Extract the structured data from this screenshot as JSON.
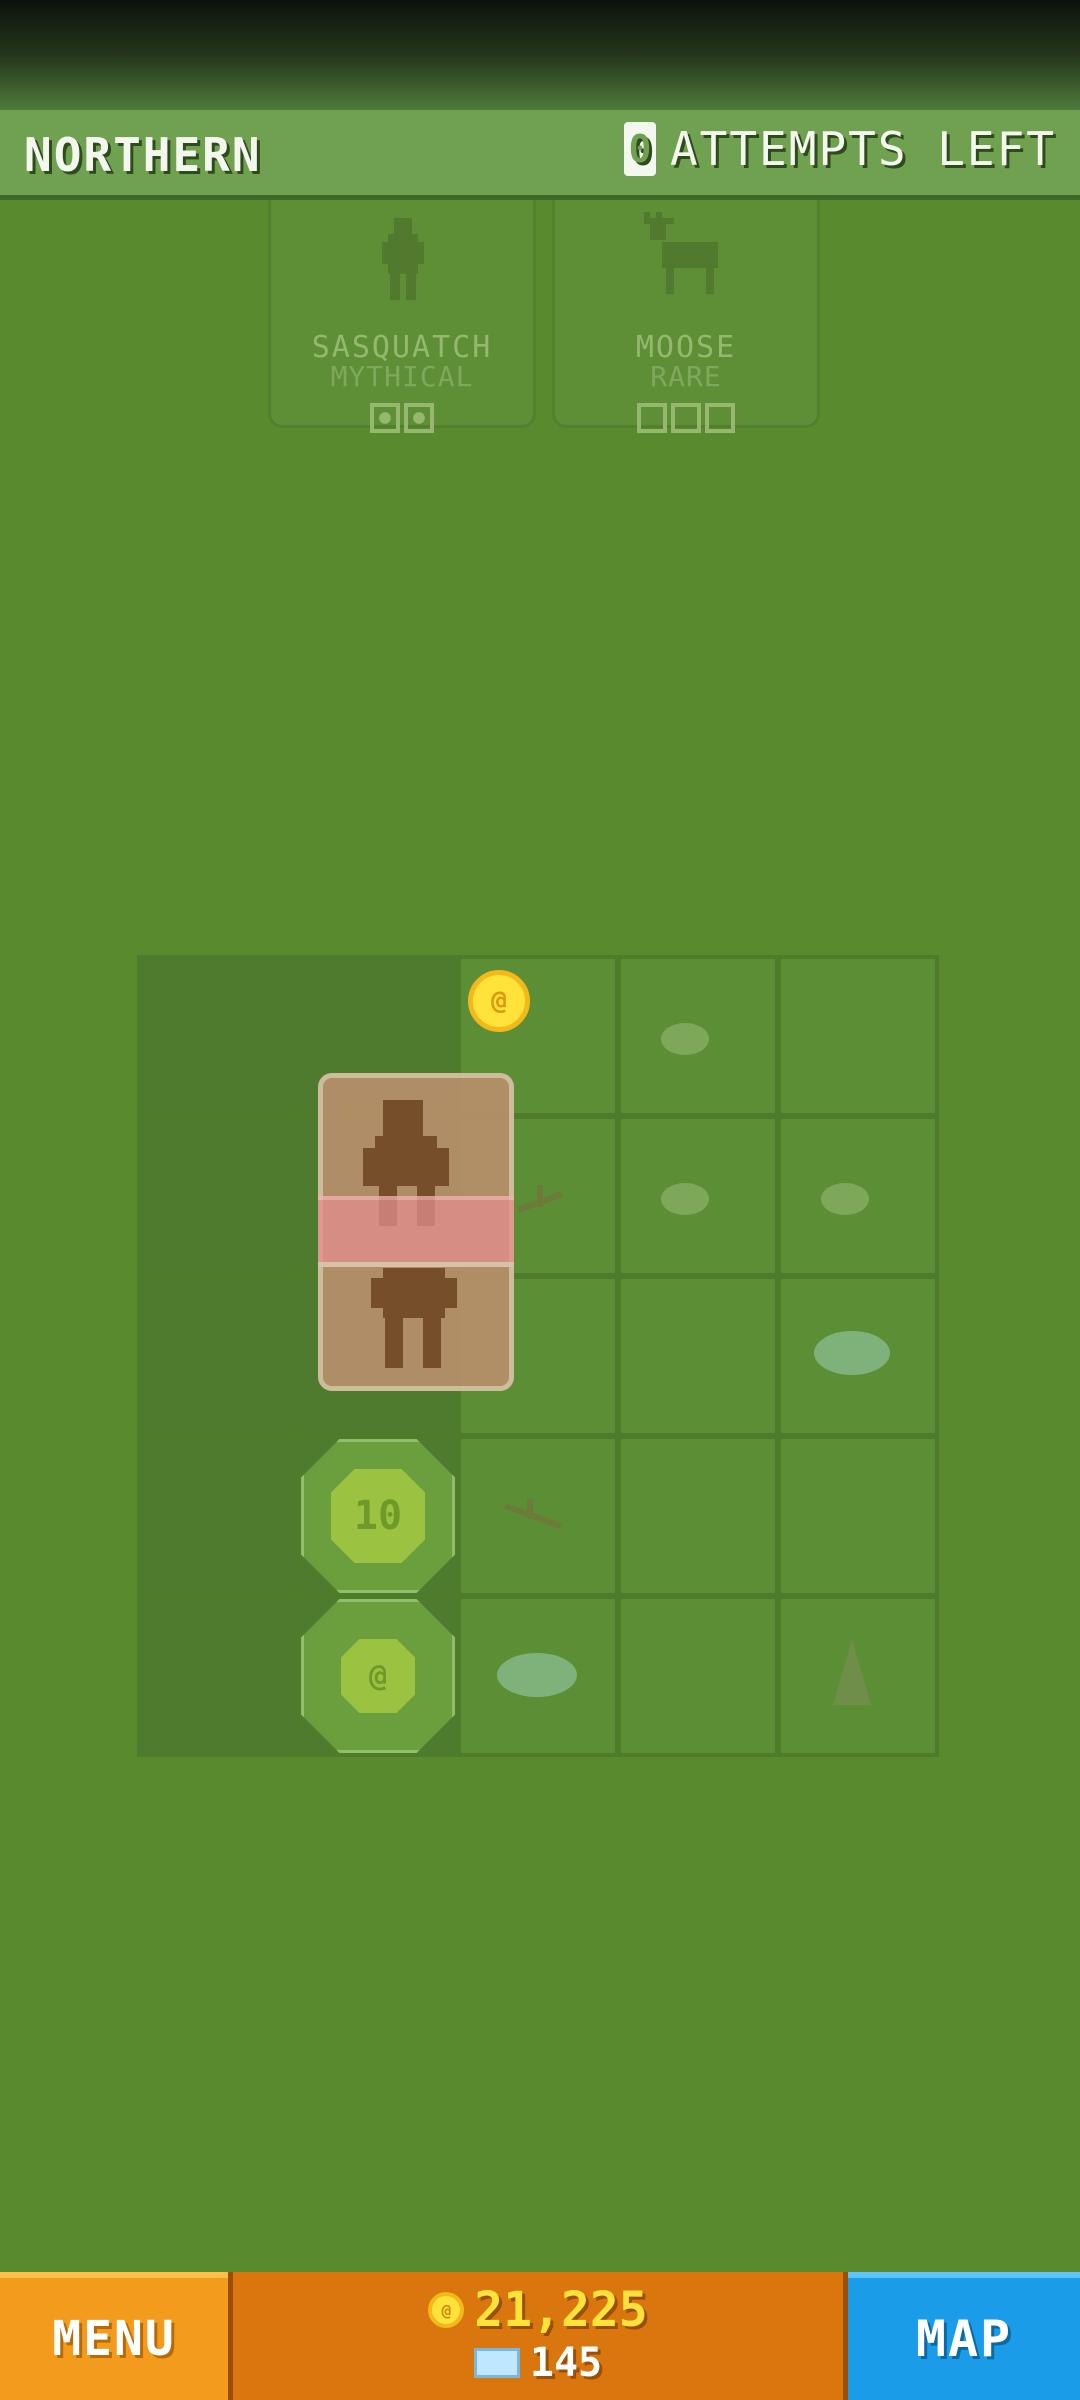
{
  "header": {
    "region": "NORTHERN",
    "attempts_count": "0",
    "attempts_label": "ATTEMPTS LEFT"
  },
  "animals": [
    {
      "name": "SASQUATCH",
      "rarity": "MYTHICAL",
      "progress_total": 2,
      "progress_found": 2,
      "icon": "sasquatch-icon"
    },
    {
      "name": "MOOSE",
      "rarity": "RARE",
      "progress_total": 3,
      "progress_found": 0,
      "icon": "moose-icon"
    }
  ],
  "board": {
    "tokens": {
      "coin_value": "10",
      "coin_small": "@"
    }
  },
  "footer": {
    "menu_label": "MENU",
    "coins": "21,225",
    "gems": "145",
    "map_label": "MAP"
  },
  "colors": {
    "grass": "#5a8a2e",
    "header": "#6fa151",
    "menu": "#f39b1c",
    "map": "#1a9ce8",
    "coin": "#ffe23a"
  }
}
